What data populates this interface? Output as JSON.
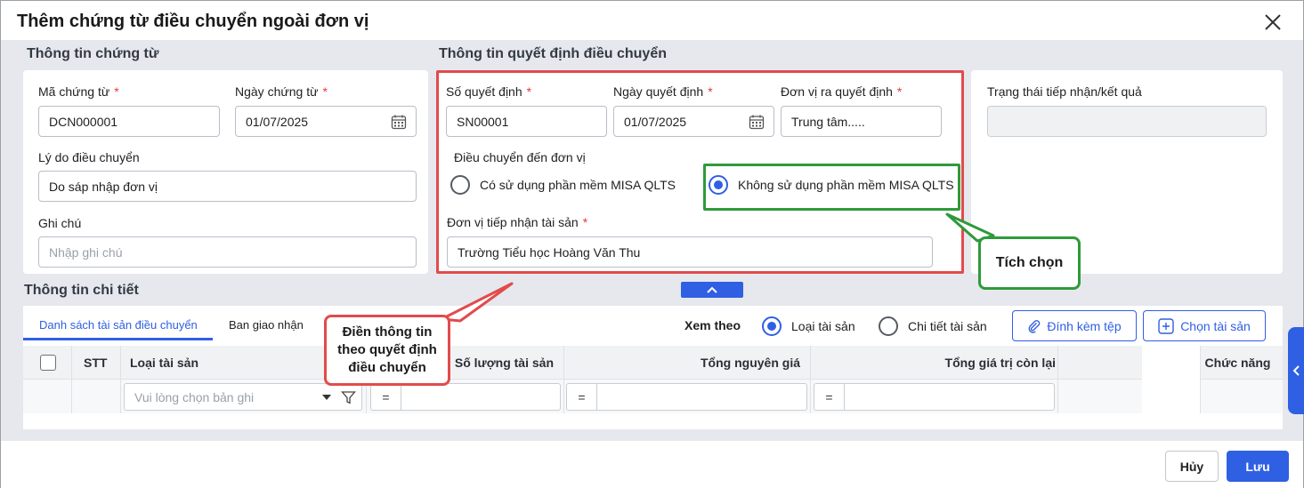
{
  "dialog": {
    "title": "Thêm chứng từ điều chuyển ngoài đơn vị"
  },
  "voucher_info": {
    "title": "Thông tin chứng từ",
    "code_label": "Mã chứng từ",
    "code_value": "DCN000001",
    "date_label": "Ngày chứng từ",
    "date_value": "01/07/2025",
    "reason_label": "Lý do điều chuyển",
    "reason_value": "Do sáp nhập đơn vị",
    "note_label": "Ghi chú",
    "note_placeholder": "Nhập ghi chú",
    "required_mark": "*"
  },
  "decision_info": {
    "title": "Thông tin quyết định điều chuyển",
    "number_label": "Số quyết định",
    "number_value": "SN00001",
    "date_label": "Ngày quyết định",
    "date_value": "01/07/2025",
    "issuer_label": "Đơn vị ra quyết định",
    "issuer_value": "Trung tâm.....",
    "transfer_to_label": "Điều chuyển đến đơn vị",
    "radio_uses": "Có sử dụng phần mềm MISA QLTS",
    "radio_not_uses": "Không sử dụng phần mềm MISA QLTS",
    "receiver_label": "Đơn vị tiếp nhận tài sản",
    "receiver_value": "Trường Tiểu học Hoàng Văn Thu"
  },
  "status": {
    "label": "Trạng thái tiếp nhận/kết quả",
    "value": ""
  },
  "detail": {
    "title": "Thông tin chi tiết",
    "tabs": [
      "Danh sách tài sản điều chuyển",
      "Ban giao nhận"
    ],
    "view_by_label": "Xem theo",
    "view_options": [
      "Loại tài sản",
      "Chi tiết tài sản"
    ],
    "attach_button": "Đính kèm tệp",
    "choose_button": "Chọn tài sản",
    "columns": [
      "STT",
      "Loại tài sản",
      "Số lượng tài sản",
      "Tổng nguyên giá",
      "Tổng giá trị còn lại",
      "Chức năng"
    ],
    "asset_type_placeholder": "Vui lòng chọn bản ghi",
    "eq_symbol": "="
  },
  "annotations": {
    "fill_callout": "Điền thông tin theo quyết định điều chuyển",
    "check_callout": "Tích chọn"
  },
  "footer": {
    "cancel_label": "Hủy",
    "save_label": "Lưu"
  },
  "colors": {
    "accent": "#2f5fe3",
    "highlight_red": "#e24b4b",
    "highlight_green": "#2e9a3b"
  }
}
